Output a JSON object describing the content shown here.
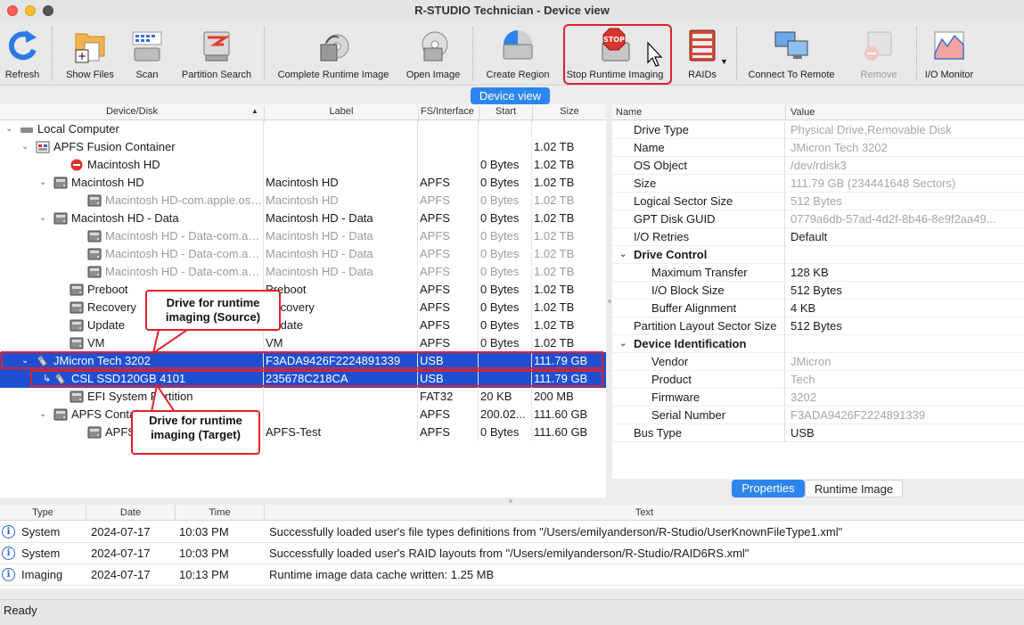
{
  "window": {
    "title": "R-STUDIO Technician - Device view"
  },
  "toolbar": {
    "buttons": [
      {
        "label": "Refresh",
        "icon": "refresh-icon"
      },
      {
        "label": "Show Files",
        "icon": "show-files-icon"
      },
      {
        "label": "Scan",
        "icon": "scan-icon"
      },
      {
        "label": "Partition Search",
        "icon": "partition-search-icon"
      },
      {
        "label": "Complete Runtime Image",
        "icon": "runtime-image-icon"
      },
      {
        "label": "Open Image",
        "icon": "open-image-icon"
      },
      {
        "label": "Create Region",
        "icon": "create-region-icon"
      },
      {
        "label": "Stop Runtime Imaging",
        "icon": "stop-icon"
      },
      {
        "label": "RAIDs",
        "icon": "raid-icon"
      },
      {
        "label": "Connect To Remote",
        "icon": "remote-icon"
      },
      {
        "label": "Remove",
        "icon": "remove-icon"
      },
      {
        "label": "I/O Monitor",
        "icon": "io-monitor-icon"
      }
    ]
  },
  "view_label": "Device view",
  "tree": {
    "columns": [
      "Device/Disk",
      "Label",
      "FS/Interface",
      "Start",
      "Size"
    ],
    "rows": [
      {
        "name": "Local Computer",
        "label": "",
        "fs": "",
        "start": "",
        "size": ""
      },
      {
        "name": "APFS Fusion Container",
        "label": "",
        "fs": "",
        "start": "",
        "size": "1.02 TB"
      },
      {
        "name": "Macintosh HD",
        "label": "",
        "fs": "",
        "start": "0 Bytes",
        "size": "1.02 TB"
      },
      {
        "name": "Macintosh HD",
        "label": "Macintosh HD",
        "fs": "APFS",
        "start": "0 Bytes",
        "size": "1.02 TB"
      },
      {
        "name": "Macintosh HD-com.apple.os....",
        "label": "Macintosh HD",
        "fs": "APFS",
        "start": "0 Bytes",
        "size": "1.02 TB"
      },
      {
        "name": "Macintosh HD - Data",
        "label": "Macintosh HD - Data",
        "fs": "APFS",
        "start": "0 Bytes",
        "size": "1.02 TB"
      },
      {
        "name": "Macintosh HD - Data-com.ap...",
        "label": "Macintosh HD - Data",
        "fs": "APFS",
        "start": "0 Bytes",
        "size": "1.02 TB"
      },
      {
        "name": "Macintosh HD - Data-com.ap...",
        "label": "Macintosh HD - Data",
        "fs": "APFS",
        "start": "0 Bytes",
        "size": "1.02 TB"
      },
      {
        "name": "Macintosh HD - Data-com.ap...",
        "label": "Macintosh HD - Data",
        "fs": "APFS",
        "start": "0 Bytes",
        "size": "1.02 TB"
      },
      {
        "name": "Preboot",
        "label": "Preboot",
        "fs": "APFS",
        "start": "0 Bytes",
        "size": "1.02 TB"
      },
      {
        "name": "Recovery",
        "label": "Recovery",
        "fs": "APFS",
        "start": "0 Bytes",
        "size": "1.02 TB"
      },
      {
        "name": "Update",
        "label": "Update",
        "fs": "APFS",
        "start": "0 Bytes",
        "size": "1.02 TB"
      },
      {
        "name": "VM",
        "label": "VM",
        "fs": "APFS",
        "start": "0 Bytes",
        "size": "1.02 TB"
      },
      {
        "name": "JMicron Tech 3202",
        "label": "F3ADA9426F2224891339",
        "fs": "USB",
        "start": "",
        "size": "111.79 GB"
      },
      {
        "name": "CSL SSD120GB 4101",
        "label": "235678C218CA",
        "fs": "USB",
        "start": "",
        "size": "111.79 GB"
      },
      {
        "name": "EFI System Partition",
        "label": "",
        "fs": "FAT32",
        "start": "20 KB",
        "size": "200 MB"
      },
      {
        "name": "APFS Container",
        "label": "",
        "fs": "APFS",
        "start": "200.02...",
        "size": "111.60 GB"
      },
      {
        "name": "APFS-Test",
        "label": "APFS-Test",
        "fs": "APFS",
        "start": "0 Bytes",
        "size": "111.60 GB"
      }
    ]
  },
  "properties": {
    "columns": [
      "Name",
      "Value"
    ],
    "rows": [
      {
        "name": "Drive Type",
        "value": "Physical Drive,Removable Disk"
      },
      {
        "name": "Name",
        "value": "JMicron Tech 3202"
      },
      {
        "name": "OS Object",
        "value": "/dev/rdisk3"
      },
      {
        "name": "Size",
        "value": "111.79 GB (234441648 Sectors)"
      },
      {
        "name": "Logical Sector Size",
        "value": "512 Bytes"
      },
      {
        "name": "GPT Disk GUID",
        "value": "0779a6db-57ad-4d2f-8b46-8e9f2aa49..."
      },
      {
        "name": "I/O Retries",
        "value": "Default"
      },
      {
        "name": "Drive Control",
        "value": ""
      },
      {
        "name": "Maximum Transfer",
        "value": "128 KB"
      },
      {
        "name": "I/O Block Size",
        "value": "512 Bytes"
      },
      {
        "name": "Buffer Alignment",
        "value": "4 KB"
      },
      {
        "name": "Partition Layout Sector Size",
        "value": "512 Bytes"
      },
      {
        "name": "Device Identification",
        "value": ""
      },
      {
        "name": "Vendor",
        "value": "JMicron"
      },
      {
        "name": "Product",
        "value": "Tech"
      },
      {
        "name": "Firmware",
        "value": "3202"
      },
      {
        "name": "Serial Number",
        "value": "F3ADA9426F2224891339"
      },
      {
        "name": "Bus Type",
        "value": "USB"
      }
    ],
    "tabs": [
      "Properties",
      "Runtime Image"
    ]
  },
  "log": {
    "columns": [
      "Type",
      "Date",
      "Time",
      "Text"
    ],
    "rows": [
      {
        "type": "System",
        "date": "2024-07-17",
        "time": "10:03 PM",
        "text": "Successfully loaded user's file types definitions from \"/Users/emilyanderson/R-Studio/UserKnownFileType1.xml\""
      },
      {
        "type": "System",
        "date": "2024-07-17",
        "time": "10:03 PM",
        "text": "Successfully loaded user's RAID layouts from \"/Users/emilyanderson/R-Studio/RAID6RS.xml\""
      },
      {
        "type": "Imaging",
        "date": "2024-07-17",
        "time": "10:13 PM",
        "text": "Runtime image data cache written: 1.25 MB"
      }
    ]
  },
  "status": "Ready",
  "annotations": {
    "source": "Drive for runtime imaging (Source)",
    "target": "Drive for runtime imaging (Target)"
  },
  "colors": {
    "accent": "#2c86ee",
    "selection": "#1f4fd1",
    "annotation": "#e0202a"
  }
}
